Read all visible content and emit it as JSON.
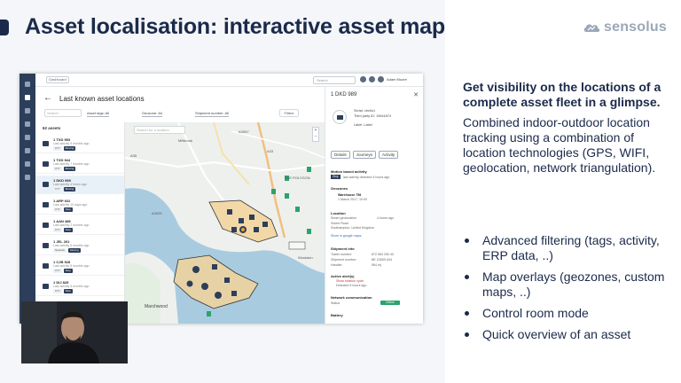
{
  "slide": {
    "title": "Asset localisation: interactive asset map",
    "brand": "sensolus",
    "heading": "Get visibility on the locations of a complete asset fleet in a glimpse.",
    "body": "Combined indoor-outdoor location tracking using a combination of location technologies (GPS, WIFI, geolocation, network triangulation).",
    "bullets": [
      "Advanced filtering (tags, activity, ERP data, ..)",
      "Map overlays (geozones, custom maps, ..)",
      "Control room mode",
      "Quick overview of an asset"
    ]
  },
  "app": {
    "crumb": "Dashboard",
    "search_placeholder": "Search",
    "user": "Adam Moore",
    "pane_title": "Last known asset locations",
    "filters": {
      "search_placeholder": "Search",
      "asset_tags": "Asset tags: All",
      "geozone": "Geozone: All",
      "shipment": "Shipment number: All",
      "more": "Filters"
    },
    "assets_count": "62 assets",
    "assets": [
      {
        "name": "1 TXD 953",
        "sub": "Last activity 9 months ago",
        "tags": [
          "CT7",
          "Moving"
        ]
      },
      {
        "name": "1 TXD 944",
        "sub": "Last activity 7 months ago",
        "tags": [
          "CT7",
          "Moving"
        ]
      },
      {
        "name": "1 DKD 989",
        "sub": "Last activity 4 hours ago",
        "tags": [
          "CT7",
          "Moving"
        ]
      },
      {
        "name": "1 ARP 922",
        "sub": "Last activity 10 days ago",
        "tags": [
          "CT7",
          "Stop"
        ]
      },
      {
        "name": "1 AAN 489",
        "sub": "Last activity 2 months ago",
        "tags": [
          "CT7",
          "Stop"
        ]
      },
      {
        "name": "1 JEL 201",
        "sub": "Last activity 6 months ago",
        "tags": [
          "Network",
          "Moving"
        ]
      },
      {
        "name": "1 CJB 928",
        "sub": "Last activity 5 months ago",
        "tags": [
          "CT7",
          "Stop"
        ]
      },
      {
        "name": "1 DIJ 825",
        "sub": "Last activity 5 months ago",
        "tags": [
          "CT7",
          "Stop"
        ]
      },
      {
        "name": "1 GCD 752",
        "sub": "Last activity 3 months ago",
        "tags": [
          "CT7"
        ]
      }
    ],
    "map": {
      "search_placeholder": "Search for a location",
      "town": "Marchwood",
      "labels": [
        "A3057",
        "A35",
        "A33",
        "THE POLYGON",
        "A3025",
        "Millbrook",
        "Woolston"
      ]
    },
    "detail": {
      "title": "1 DKD 989",
      "serial_label": "Serial:",
      "serial": "xhx9u1",
      "third_party_label": "Third party ID:",
      "third_party": "19641874",
      "labels": [
        "Label",
        "Label"
      ],
      "tabs": [
        "Details",
        "Journeys",
        "Activity"
      ],
      "motion_title": "Motion based activity",
      "motion_badge": "Stop",
      "motion_text": "last activity detected 4 hours ago",
      "geozones_title": "Geozones",
      "geozone_name": "Warehouse 758",
      "geozone_date": "1 March 2017, 10:00",
      "location_title": "Location",
      "location_badge": "Smart geolocation",
      "location_time": "4 hours ago",
      "location_lines": [
        "Solent Road",
        "Southampton, United Kingdom"
      ],
      "google_maps": "Show in google maps",
      "shipment_title": "Shipment info",
      "shipment_rows": [
        {
          "k": "Trailer number:",
          "v": "872 983 250 40"
        },
        {
          "k": "Shipment number:",
          "v": "BE 22659 A34"
        },
        {
          "k": "Handler:",
          "v": "964 mj"
        }
      ],
      "alerts_title": "Active alert(s)",
      "alert_name": "Show rotation cycle",
      "alert_time": "Detected 5 hours ago",
      "network_title": "Network communication",
      "status_label": "Status",
      "status_value": "Online",
      "battery_title": "Battery"
    }
  },
  "colors": {
    "navy": "#1b2a4b",
    "rail": "#2c3e5a",
    "zone_fill": "#f2d39a",
    "water": "#a9cbe0",
    "online": "#2ba36c"
  }
}
